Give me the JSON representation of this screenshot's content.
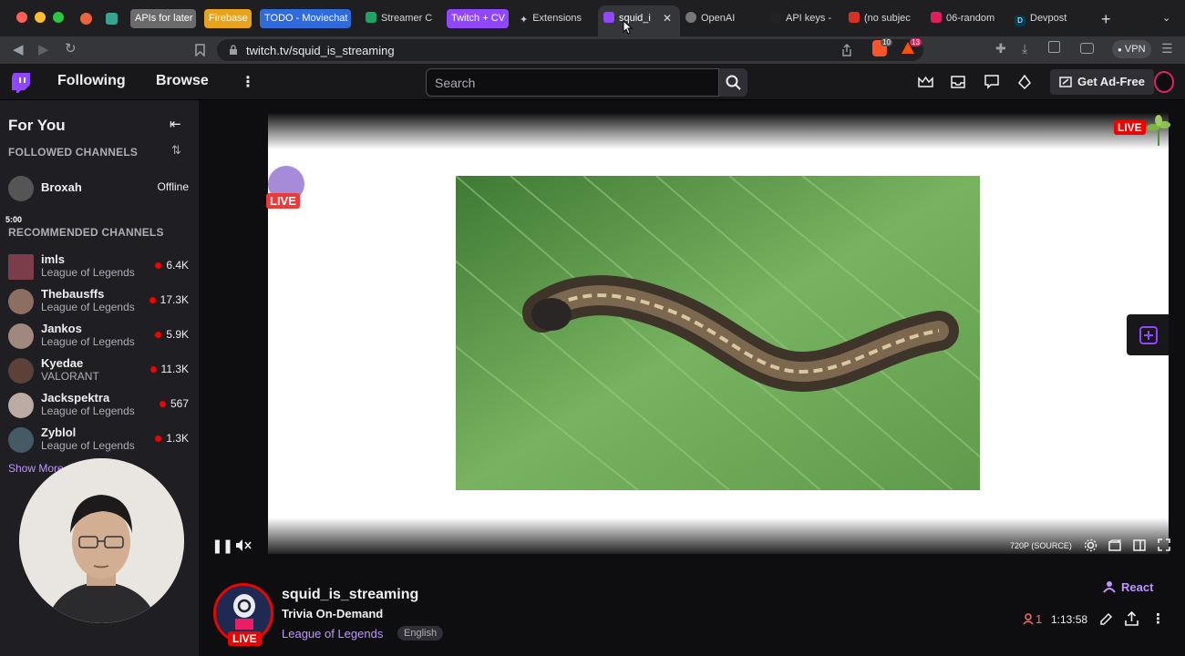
{
  "browser": {
    "tabs": [
      {
        "label": "APIs for later",
        "bg": "#6b6b6b"
      },
      {
        "label": "Firebase",
        "bg": "#f5a623"
      },
      {
        "label": "TODO - Moviechat",
        "bg": "#2f6bdc"
      },
      {
        "label": "Streamer C"
      },
      {
        "label": "Twitch + CV",
        "bg": "#9146ff"
      },
      {
        "label": "Extensions"
      },
      {
        "label": "squid_i"
      },
      {
        "label": "OpenAI"
      },
      {
        "label": "API keys -"
      },
      {
        "label": "(no subjec"
      },
      {
        "label": "06-random"
      },
      {
        "label": "Devpost"
      }
    ],
    "url": "twitch.tv/squid_is_streaming",
    "shield_count": "10",
    "alert_count": "13",
    "vpn_label": "VPN"
  },
  "twitch": {
    "nav": {
      "following": "Following",
      "browse": "Browse",
      "search_placeholder": "Search",
      "ad_free": "Get Ad-Free"
    },
    "sidebar": {
      "title": "For You",
      "followed_header": "FOLLOWED CHANNELS",
      "followed": [
        {
          "name": "Broxah",
          "status": "Offline"
        }
      ],
      "webcam_time": "5:00",
      "recommended_header": "RECOMMENDED CHANNELS",
      "recommended": [
        {
          "name": "imls",
          "game": "League of Legends",
          "viewers": "6.4K"
        },
        {
          "name": "Thebausffs",
          "game": "League of Legends",
          "viewers": "17.3K"
        },
        {
          "name": "Jankos",
          "game": "League of Legends",
          "viewers": "5.9K"
        },
        {
          "name": "Kyedae",
          "game": "VALORANT",
          "viewers": "11.3K"
        },
        {
          "name": "Jackspektra",
          "game": "League of Legends",
          "viewers": "567"
        },
        {
          "name": "Zyblol",
          "game": "League of Legends",
          "viewers": "1.3K"
        }
      ],
      "show_more": "Show More"
    },
    "player": {
      "live_badge": "LIVE",
      "live_corner": "LIVE",
      "quality": "720P (SOURCE)"
    },
    "stream": {
      "channel": "squid_is_streaming",
      "title": "Trivia On-Demand",
      "game": "League of Legends",
      "language": "English",
      "live": "LIVE",
      "react": "React",
      "viewers": "1",
      "uptime": "1:13:58"
    }
  }
}
